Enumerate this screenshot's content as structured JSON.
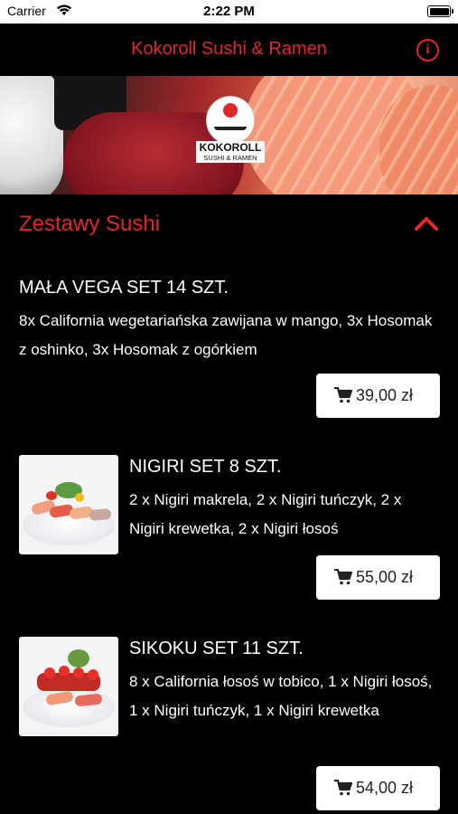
{
  "status_bar": {
    "carrier": "Carrier",
    "time": "2:22 PM"
  },
  "nav": {
    "title": "Kokoroll Sushi & Ramen",
    "info_icon": "i"
  },
  "hero": {
    "logo_name": "KOKOROLL",
    "logo_sub": "SUSHI & RAMEN"
  },
  "section": {
    "title": "Zestawy Sushi",
    "expanded": true
  },
  "items": [
    {
      "name": "MAŁA VEGA SET 14 SZT.",
      "description": "8x California wegetariańska zawijana w mango, 3x Hosomak z oshinko, 3x Hosomak z ogórkiem",
      "price": "39,00 zł",
      "has_image": false
    },
    {
      "name": "NIGIRI SET 8 SZT.",
      "description": "2 x Nigiri makrela, 2 x Nigiri tuńczyk, 2 x Nigiri krewetka, 2 x Nigiri łosoś",
      "price": "55,00 zł",
      "has_image": true
    },
    {
      "name": "SIKOKU SET 11 SZT.",
      "description": "8 x California łosoś w tobico, 1 x Nigiri łosoś, 1 x Nigiri tuńczyk, 1 x Nigiri krewetka",
      "price": "54,00 zł",
      "has_image": true
    }
  ],
  "colors": {
    "accent": "#e02828",
    "background": "#000000",
    "button_bg": "#ffffff"
  },
  "icons": [
    "wifi-icon",
    "battery-icon",
    "info-icon",
    "chevron-up-icon",
    "cart-icon"
  ]
}
